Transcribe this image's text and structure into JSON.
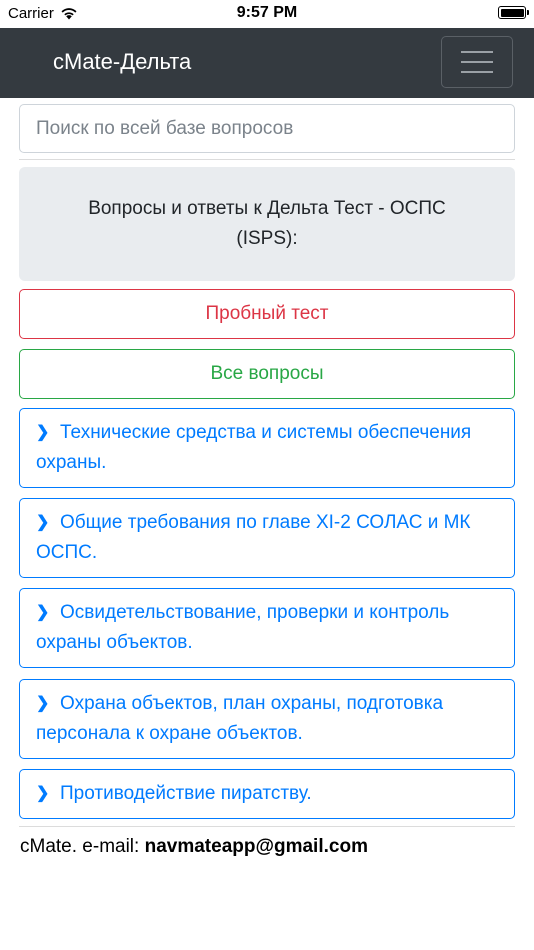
{
  "status": {
    "carrier": "Carrier",
    "time": "9:57 PM"
  },
  "navbar": {
    "brand": "cMate-Дельта"
  },
  "search": {
    "placeholder": "Поиск по всей базе вопросов"
  },
  "jumbotron": {
    "text": "Вопросы и ответы к Дельта Тест - ОСПС (ISPS):"
  },
  "buttons": {
    "trial_test": "Пробный тест",
    "all_questions": "Все вопросы"
  },
  "topics": [
    {
      "label": "Технические средства и системы обеспечения охраны."
    },
    {
      "label": "Общие требования по главе XI-2 СОЛАС и МК ОСПС."
    },
    {
      "label": "Освидетельствование, проверки и контроль охраны объектов."
    },
    {
      "label": "Охрана объектов, план охраны, подготовка персонала к охране объектов."
    },
    {
      "label": "Противодействие пиратству."
    }
  ],
  "footer": {
    "prefix": "cMate. e-mail: ",
    "email": "navmateapp@gmail.com"
  },
  "colors": {
    "navbar": "#343a40",
    "danger": "#dc3545",
    "success": "#28a745",
    "primary": "#007bff"
  }
}
